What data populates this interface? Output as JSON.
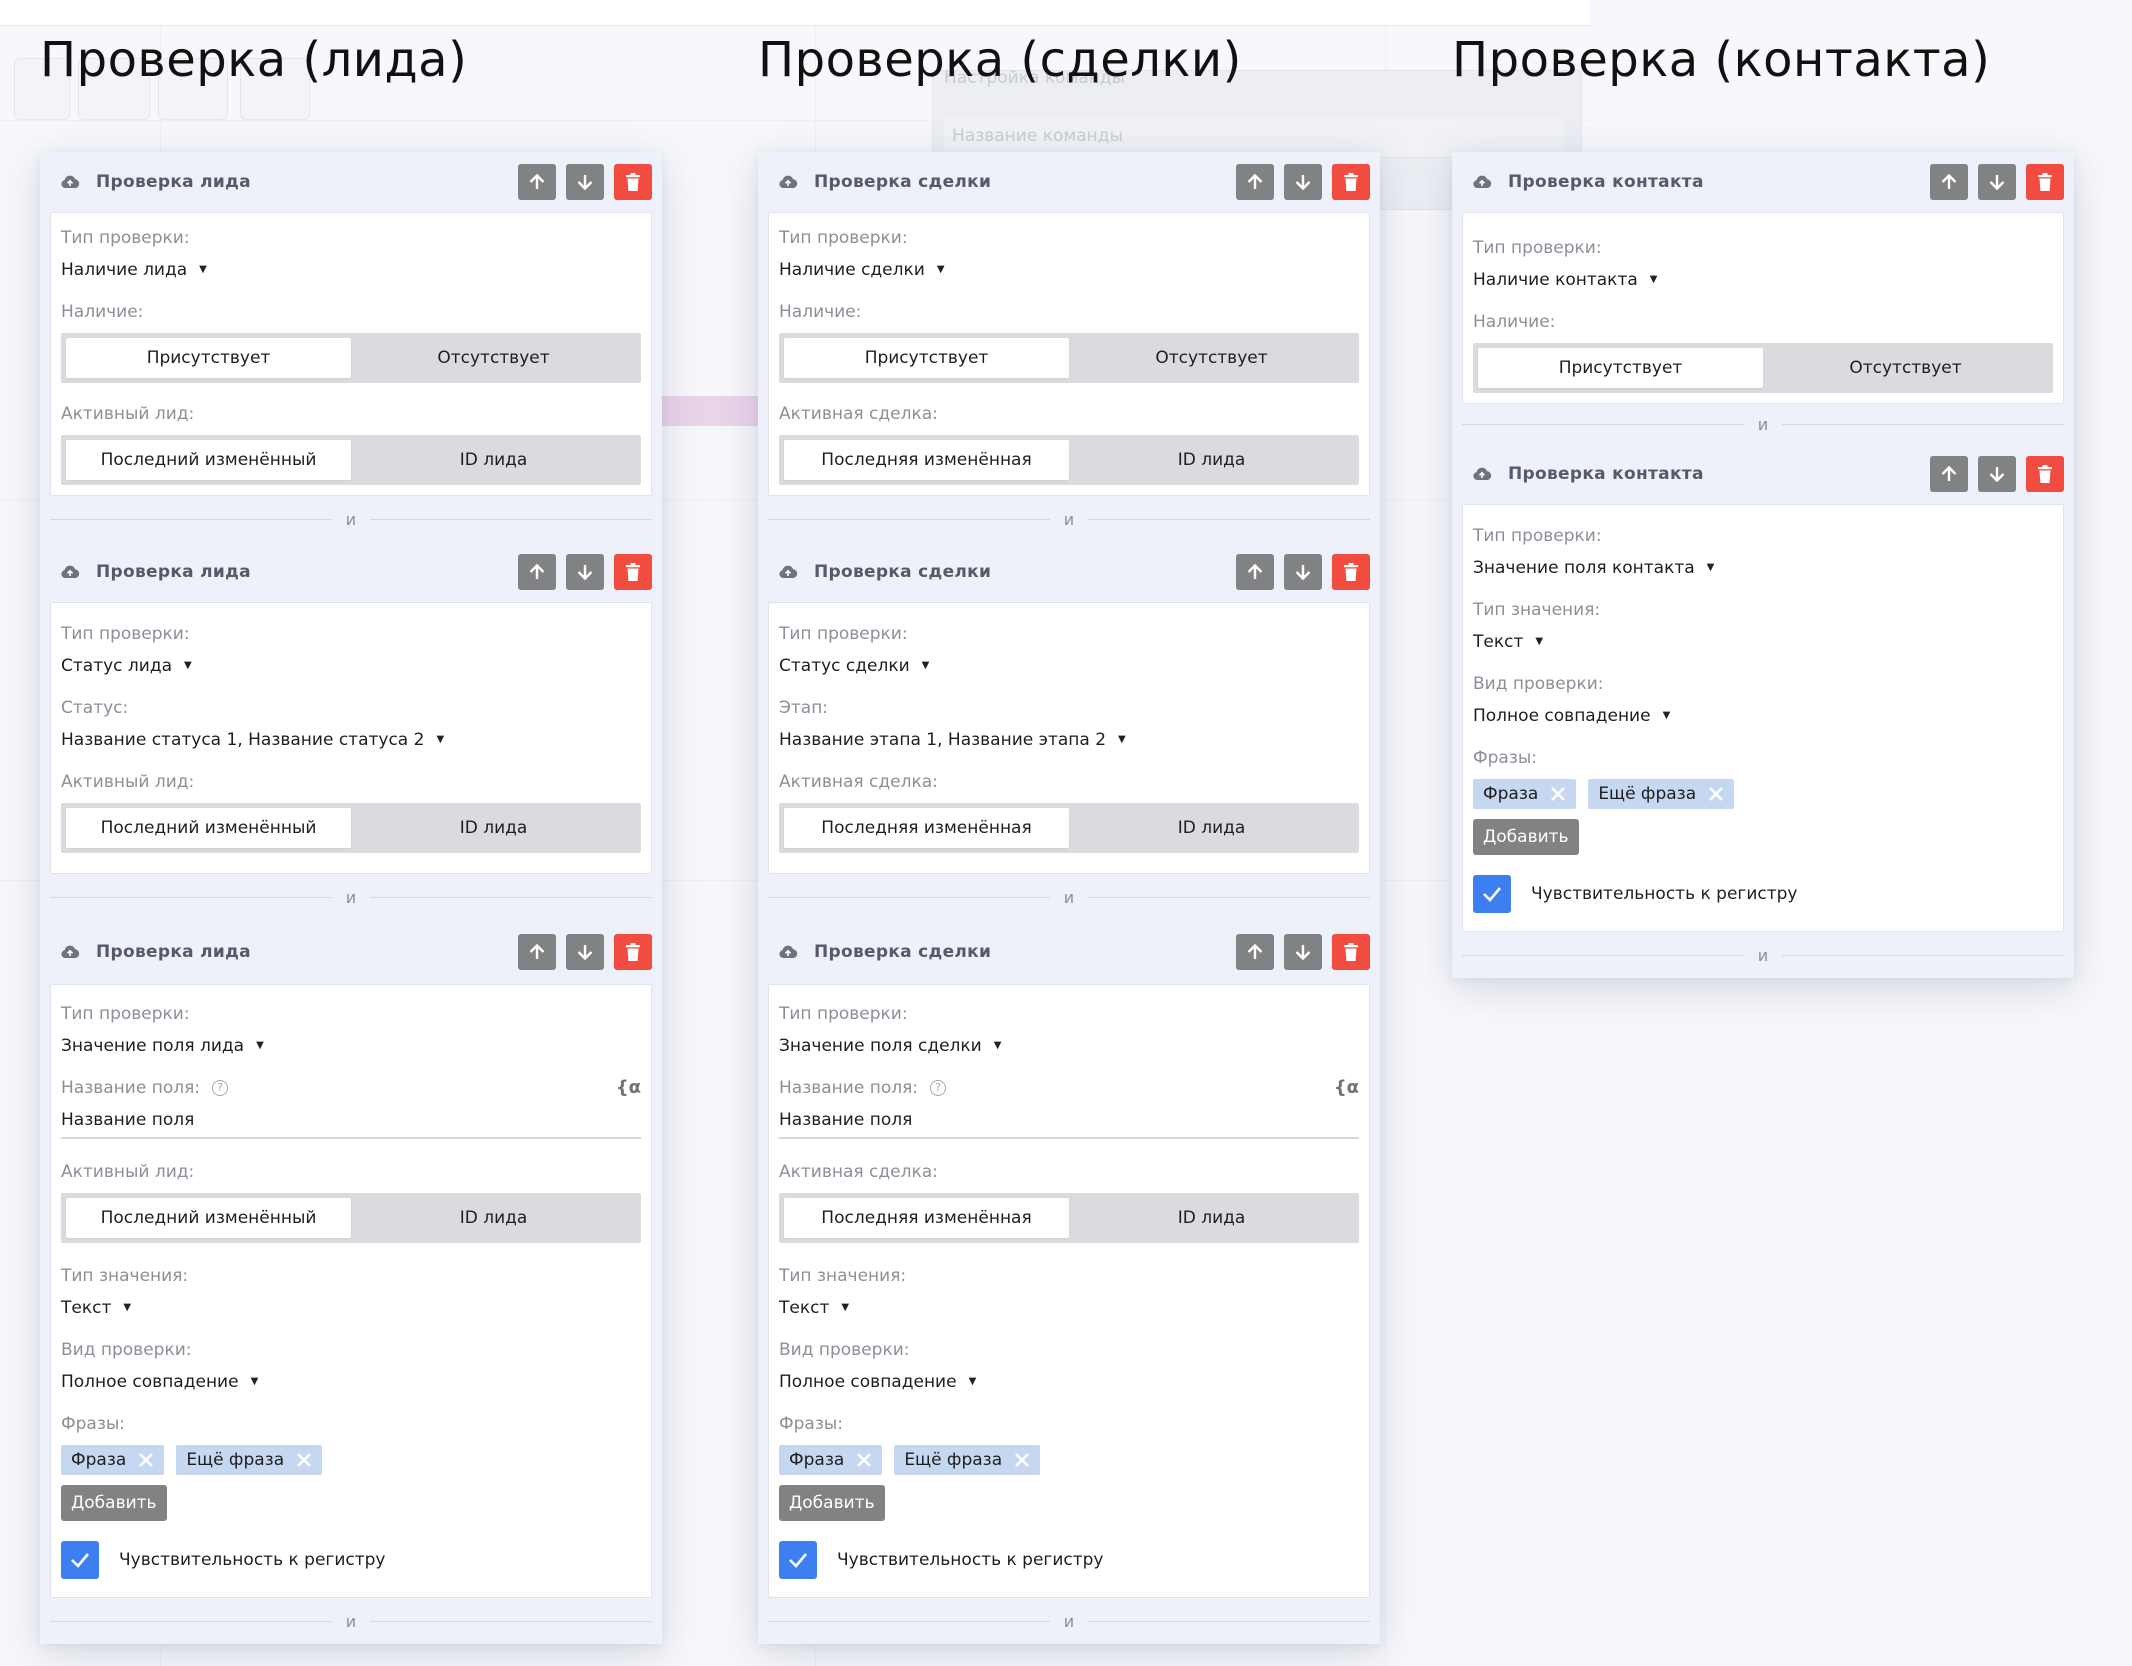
{
  "colors": {
    "accent_blue": "#3d7ef0",
    "delete_red": "#f24b3f",
    "button_gray": "#808284",
    "chip_blue": "#c6d7f2"
  },
  "background": {
    "ghost_title": "Настройка команды",
    "ghost_field": "Название команды"
  },
  "headings": [
    "Проверка (лида)",
    "Проверка (сделки)",
    "Проверка (контакта)"
  ],
  "common": {
    "check_type_label": "Тип проверки:",
    "presence_label": "Наличие:",
    "present": "Присутствует",
    "absent": "Отсутствует",
    "id_option": "ID лида",
    "and": "и",
    "field_name_label": "Название поля:",
    "field_name_value": "Название поля",
    "value_type_label": "Тип значения:",
    "value_type_value": "Текст",
    "check_kind_label": "Вид проверки:",
    "check_kind_value": "Полное совпадение",
    "phrases_label": "Фразы:",
    "phrase_1": "Фраза",
    "phrase_2": "Ещё фраза",
    "add_button": "Добавить",
    "case_sensitive": "Чувствительность к регистру",
    "help_glyph": "?",
    "var_glyph": "{α"
  },
  "lead": {
    "block_title": "Проверка лида",
    "presence_type": "Наличие лида",
    "active_label": "Активный лид:",
    "last_changed": "Последний изменённый",
    "status_type": "Статус лида",
    "status_label": "Статус:",
    "status_value": "Название статуса 1, Название статуса 2",
    "field_type": "Значение поля лида"
  },
  "deal": {
    "block_title": "Проверка сделки",
    "presence_type": "Наличие сделки",
    "active_label": "Активная сделка:",
    "last_changed": "Последняя изменённая",
    "status_type": "Статус сделки",
    "status_label": "Этап:",
    "status_value": "Название этапа 1, Название этапа 2",
    "field_type": "Значение поля сделки"
  },
  "contact": {
    "block_title": "Проверка контакта",
    "presence_type": "Наличие контакта",
    "field_type": "Значение поля контакта"
  }
}
